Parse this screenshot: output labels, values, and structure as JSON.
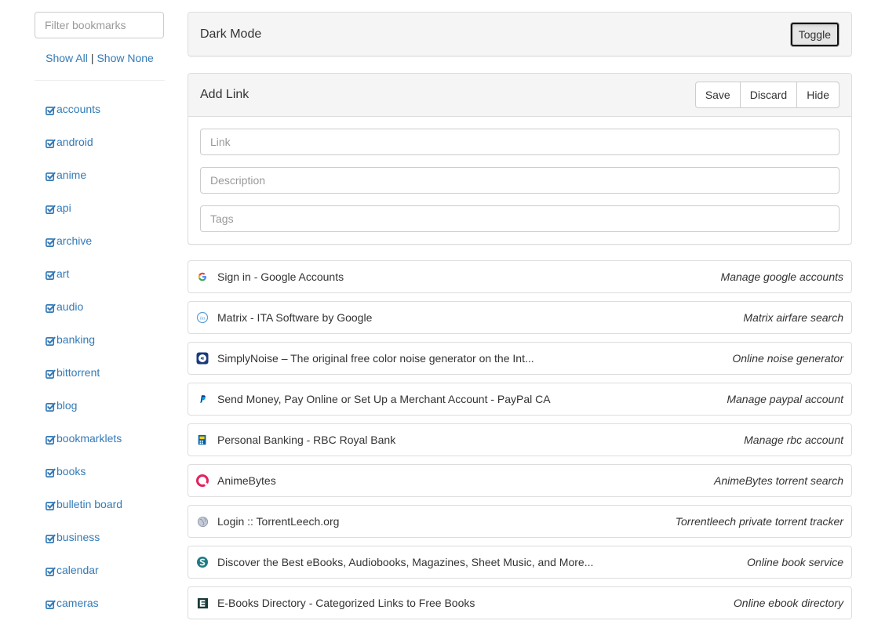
{
  "sidebar": {
    "filter_placeholder": "Filter bookmarks",
    "show_all": "Show All",
    "separator": "|",
    "show_none": "Show None",
    "tags": [
      "accounts",
      "android",
      "anime",
      "api",
      "archive",
      "art",
      "audio",
      "banking",
      "bittorrent",
      "blog",
      "bookmarklets",
      "books",
      "bulletin board",
      "business",
      "calendar",
      "cameras"
    ]
  },
  "dark_mode": {
    "title": "Dark Mode",
    "toggle_label": "Toggle"
  },
  "add_link": {
    "title": "Add Link",
    "save_label": "Save",
    "discard_label": "Discard",
    "hide_label": "Hide",
    "link_placeholder": "Link",
    "description_placeholder": "Description",
    "tags_placeholder": "Tags"
  },
  "links": [
    {
      "icon": "google-icon",
      "title": "Sign in - Google Accounts",
      "description": "Manage google accounts"
    },
    {
      "icon": "ita-icon",
      "title": "Matrix - ITA Software by Google",
      "description": "Matrix airfare search"
    },
    {
      "icon": "simplynoise-icon",
      "title": "SimplyNoise – The original free color noise generator on the Int...",
      "description": "Online noise generator"
    },
    {
      "icon": "paypal-icon",
      "title": "Send Money, Pay Online or Set Up a Merchant Account - PayPal CA",
      "description": "Manage paypal account"
    },
    {
      "icon": "rbc-icon",
      "title": "Personal Banking - RBC Royal Bank",
      "description": "Manage rbc account"
    },
    {
      "icon": "animebytes-icon",
      "title": "AnimeBytes",
      "description": "AnimeBytes torrent search"
    },
    {
      "icon": "globe-icon",
      "title": "Login :: TorrentLeech.org",
      "description": "Torrentleech private torrent tracker"
    },
    {
      "icon": "scribd-icon",
      "title": "Discover the Best eBooks, Audiobooks, Magazines, Sheet Music, and More...",
      "description": "Online book service"
    },
    {
      "icon": "ebooks-directory-icon",
      "title": "E-Books Directory - Categorized Links to Free Books",
      "description": "Online ebook directory"
    }
  ],
  "colors": {
    "link": "#337ab7",
    "heading_bg": "#f5f5f5",
    "border": "#dddddd"
  }
}
